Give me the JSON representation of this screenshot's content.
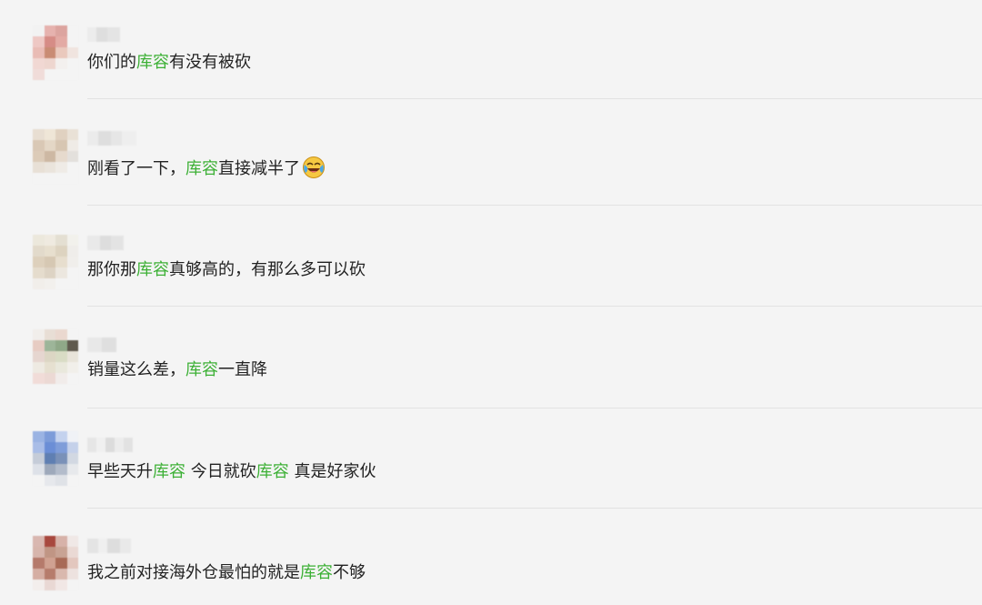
{
  "comments": [
    {
      "parts": [
        {
          "text": "你们的",
          "hl": false
        },
        {
          "text": "库容",
          "hl": true
        },
        {
          "text": "有没有被砍",
          "hl": false
        }
      ],
      "emoji": null
    },
    {
      "parts": [
        {
          "text": "刚看了一下，",
          "hl": false
        },
        {
          "text": "库容",
          "hl": true
        },
        {
          "text": "直接减半了",
          "hl": false
        }
      ],
      "emoji": "laughing-crying-emoji"
    },
    {
      "parts": [
        {
          "text": "那你那",
          "hl": false
        },
        {
          "text": "库容",
          "hl": true
        },
        {
          "text": "真够高的，有那么多可以砍",
          "hl": false
        }
      ],
      "emoji": null
    },
    {
      "parts": [
        {
          "text": "销量这么差，",
          "hl": false
        },
        {
          "text": "库容",
          "hl": true
        },
        {
          "text": "一直降",
          "hl": false
        }
      ],
      "emoji": null
    },
    {
      "parts": [
        {
          "text": "早些天升",
          "hl": false
        },
        {
          "text": "库容",
          "hl": true
        },
        {
          "text": " 今日就砍",
          "hl": false
        },
        {
          "text": "库容",
          "hl": true
        },
        {
          "text": " 真是好家伙",
          "hl": false
        }
      ],
      "emoji": null
    },
    {
      "parts": [
        {
          "text": "我之前对接海外仓最怕的就是",
          "hl": false
        },
        {
          "text": "库容",
          "hl": true
        },
        {
          "text": "不够",
          "hl": false
        }
      ],
      "emoji": null
    }
  ],
  "colors": {
    "background": "#f4f4f4",
    "text": "#222222",
    "highlight": "#3cb035",
    "divider": "#e2e2e2"
  }
}
